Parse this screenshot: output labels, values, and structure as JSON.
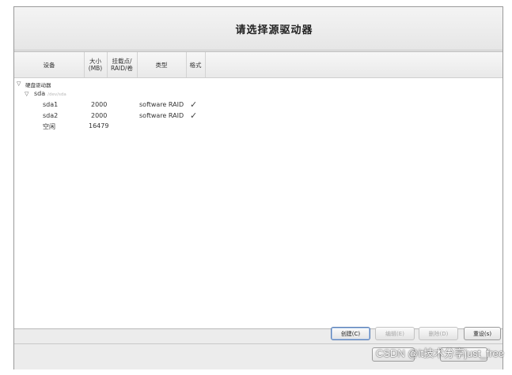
{
  "title": "请选择源驱动器",
  "columns": {
    "device": "设备",
    "size": "大小\n(MB)",
    "mount": "挂载点/\nRAID/卷",
    "type": "类型",
    "format": "格式"
  },
  "tree": {
    "group_label": "硬盘驱动器",
    "disk_label": "sda",
    "disk_note": "/dev/sda",
    "rows": [
      {
        "device": "sda1",
        "size": "2000",
        "type": "software RAID",
        "format": "✓"
      },
      {
        "device": "sda2",
        "size": "2000",
        "type": "software RAID",
        "format": "✓"
      },
      {
        "device": "空闲",
        "size": "16479",
        "type": "",
        "format": ""
      }
    ]
  },
  "buttons": {
    "create": "创建(C)",
    "edit": "编辑(E)",
    "delete": "删除(D)",
    "reset": "重设(s)"
  },
  "watermark": "CSDN @it技术分享just_free"
}
